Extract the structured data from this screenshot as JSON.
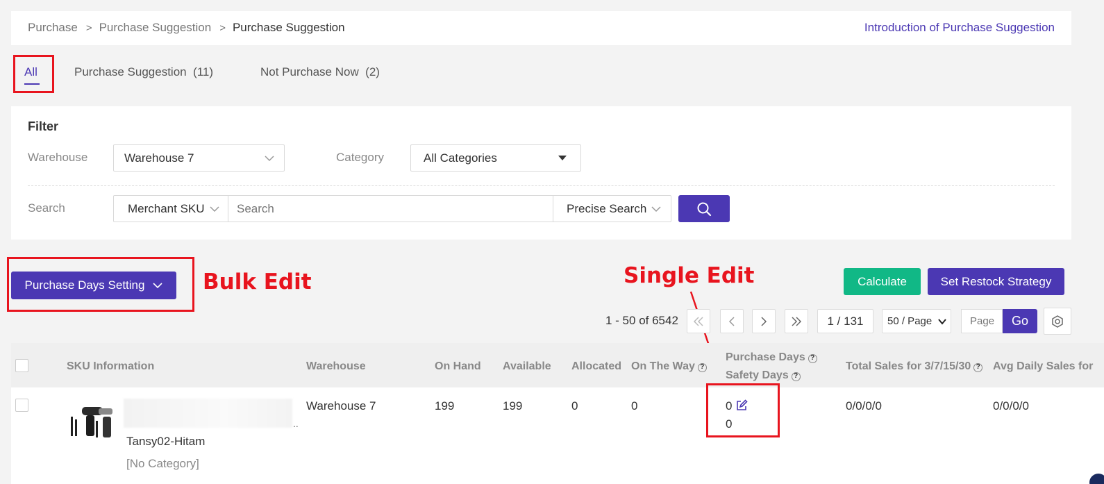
{
  "breadcrumb": {
    "items": [
      "Purchase",
      "Purchase Suggestion",
      "Purchase Suggestion"
    ],
    "separator": ">",
    "intro_link": "Introduction of Purchase Suggestion"
  },
  "tabs": [
    {
      "label": "All"
    },
    {
      "label": "Purchase Suggestion  (11)"
    },
    {
      "label": "Not Purchase Now  (2)"
    }
  ],
  "filter": {
    "title": "Filter",
    "warehouse_label": "Warehouse",
    "warehouse_value": "Warehouse 7",
    "category_label": "Category",
    "category_value": "All Categories",
    "search_label": "Search",
    "search_field": "Merchant SKU",
    "search_placeholder": "Search",
    "search_mode": "Precise Search"
  },
  "toolbar": {
    "purchase_days_setting": "Purchase Days Setting",
    "calculate": "Calculate",
    "set_restock_strategy": "Set Restock Strategy"
  },
  "annotations": {
    "bulk_edit": "Bulk Edit",
    "single_edit": "Single Edit"
  },
  "pagination": {
    "range": "1 - 50 of 6542",
    "page_value": "1 / 131",
    "page_size": "50 / Page",
    "page_placeholder": "Page",
    "go": "Go"
  },
  "table": {
    "headers": {
      "sku": "SKU Information",
      "warehouse": "Warehouse",
      "on_hand": "On Hand",
      "available": "Available",
      "allocated": "Allocated",
      "on_the_way": "On The Way",
      "purchase_days": "Purchase Days",
      "safety_days": "Safety Days",
      "total_sales": "Total Sales for 3/7/15/30",
      "avg_daily": "Avg Daily Sales for"
    },
    "rows": [
      {
        "name_suffix": "..",
        "sku": "Tansy02-Hitam",
        "category": "[No Category]",
        "warehouse": "Warehouse 7",
        "on_hand": "199",
        "available": "199",
        "allocated": "0",
        "on_the_way": "0",
        "purchase_days": "0",
        "safety_days": "0",
        "total_sales": "0/0/0/0",
        "avg_daily": "0/0/0/0"
      }
    ]
  },
  "colors": {
    "accent": "#4b38b3",
    "green": "#11b886",
    "annotation_red": "#e8141e"
  }
}
